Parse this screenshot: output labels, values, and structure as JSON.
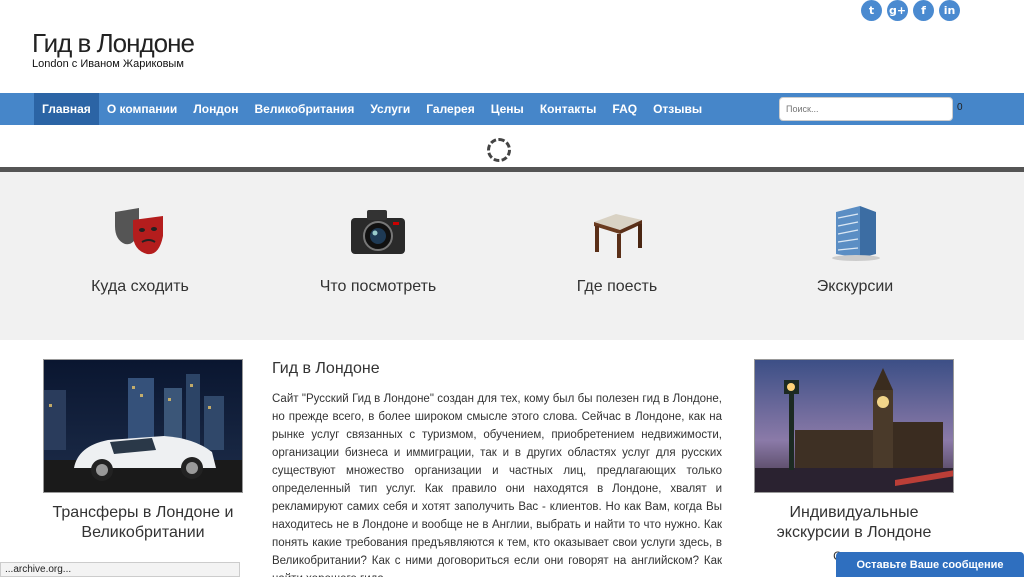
{
  "social": [
    "t",
    "g+",
    "f",
    "in"
  ],
  "social_icons": [
    "twitter-icon",
    "google-plus-icon",
    "facebook-icon",
    "linkedin-icon"
  ],
  "brand": {
    "title": "Гид в Лондоне",
    "tagline": "London с Иваном Жариковым"
  },
  "nav": {
    "items": [
      "Главная",
      "О компании",
      "Лондон",
      "Великобритания",
      "Услуги",
      "Галерея",
      "Цены",
      "Контакты",
      "FAQ",
      "Отзывы"
    ],
    "search_placeholder": "Поиск...",
    "cart_count": "0"
  },
  "features": [
    {
      "label": "Куда сходить",
      "icon": "theater-masks-icon"
    },
    {
      "label": "Что посмотреть",
      "icon": "camera-icon"
    },
    {
      "label": "Где поесть",
      "icon": "table-icon"
    },
    {
      "label": "Экскурсии",
      "icon": "building-icon"
    }
  ],
  "left_card": {
    "title": "Трансферы в Лондоне и Великобритании"
  },
  "right_card": {
    "title": "Индивидуальные экскурсии в Лондоне",
    "sub": "Описан"
  },
  "article": {
    "title": "Гид в Лондоне",
    "text": "Сайт \"Русский Гид в Лондоне\" создан для тех, кому был бы полезен гид в Лондоне, но прежде всего, в более широком смысле этого слова. Сейчас в Лондоне, как на рынке услуг связанных с туризмом, обучением, приобретением недвижимости, организации бизнеса и иммиграции, так и в других областях услуг для русских существуют множество организации и частных лиц, предлагающих только определенный тип услуг. Как правило они находятся в Лондоне, хвалят и рекламируют самих себя и хотят заполучить Вас - клиентов. Но как Вам, когда Вы находитесь не в Лондоне и вообще не в Англии, выбрать и найти то что нужно. Как понять какие требования предъявляются к тем, кто оказывает свои услуги здесь, в Великобритании? Как с ними договориться если они говорят на английском? Как найти хорошего гида -"
  },
  "chat_label": "Оставьте Ваше сообщение",
  "status_text": "...archive.org..."
}
